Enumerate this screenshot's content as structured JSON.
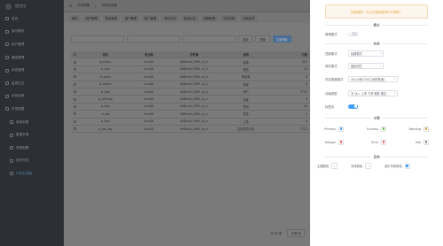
{
  "sidebar": {
    "logo_text": "很拉拉",
    "items": [
      {
        "label": "首页",
        "has_chev": false,
        "sub": false,
        "active": false
      },
      {
        "label": "演示模块",
        "has_chev": true,
        "sub": false,
        "active": false
      },
      {
        "label": "用户管理",
        "has_chev": true,
        "sub": false,
        "active": false
      },
      {
        "label": "通信管理",
        "has_chev": true,
        "sub": false,
        "active": false
      },
      {
        "label": "系统管理",
        "has_chev": true,
        "sub": false,
        "active": false
      },
      {
        "label": "监测日志",
        "has_chev": true,
        "sub": false,
        "active": false
      },
      {
        "label": "系统运维",
        "has_chev": true,
        "sub": false,
        "active": false
      },
      {
        "label": "开发配置",
        "has_chev": true,
        "sub": false,
        "active": false
      },
      {
        "label": "菜单权限",
        "has_chev": false,
        "sub": true,
        "active": false
      },
      {
        "label": "数据字典",
        "has_chev": false,
        "sub": true,
        "active": false
      },
      {
        "label": "参数配置",
        "has_chev": false,
        "sub": true,
        "active": false
      },
      {
        "label": "定时任务",
        "has_chev": false,
        "sub": true,
        "active": false
      },
      {
        "label": "代码生成器",
        "has_chev": false,
        "sub": true,
        "active": true
      }
    ]
  },
  "topbar": {
    "breadcrumb": [
      "开发配置",
      "代码生成器"
    ]
  },
  "tabs": [
    "首页",
    "用户管理",
    "角色管理",
    "部门管理",
    "部门管理",
    "操作日志",
    "登录日志",
    "参数配置",
    "文件列表",
    "代码生成"
  ],
  "filter": {
    "input1": "...",
    "input2": "...",
    "input3": "...",
    "search_label": "查询",
    "reset_label": "重置",
    "add_label": "生成代码"
  },
  "table": {
    "headers": [
      "表名",
      "表注释",
      "字符集",
      "说明",
      "行数"
    ],
    "rows": [
      [
        "b_menu",
        "inno08",
        "utf8mb4_0900_ai_ci",
        "菜单",
        "321"
      ],
      [
        "b_role",
        "inno08",
        "utf8mb4_0900_ai_ci",
        "角色",
        "14"
      ],
      [
        "b_perm",
        "inno08",
        "utf8mb4_0900_ai_ci",
        "商品类",
        "8"
      ],
      [
        "b_setpar",
        "inno08",
        "utf8mb4_0900_ai_ci",
        "参数",
        "0"
      ],
      [
        "b_user",
        "inno08",
        "utf8mb4_0900_ai_ci",
        "用户",
        "2747"
      ],
      [
        "b_settings",
        "inno08",
        "utf8mb4_0900_ai_ci",
        "设置",
        "0"
      ],
      [
        "b_sign",
        "inno08",
        "utf8mb4_0900_ai_ci",
        "签到",
        "22"
      ],
      [
        "b_xdt",
        "inno08",
        "utf8mb4_0900_ai_ci",
        "任务",
        "2"
      ],
      [
        "b_tool",
        "inno08",
        "utf8mb4_0900_ai_ci",
        "工具",
        "0"
      ],
      [
        "b_job_log",
        "inno08",
        "utf8mb4_0900_ai_ci",
        "定时任务日志",
        "1722"
      ]
    ]
  },
  "pager": {
    "total": "共 36 条",
    "size": "10条/页"
  },
  "settings": {
    "alert": "你是谁呀，可以引导给提供什么帮助？",
    "sections": {
      "mode": "模式",
      "layout": "布局",
      "theme": "主题",
      "other": "其他"
    },
    "dark_mode_label": "暗黑模式",
    "layout_label": "顶部模式",
    "layout_value": "经典模式",
    "sidebar_label": "侧栏模式",
    "sidebar_value": "固定侧栏",
    "content_label": "内容宽度模式",
    "content_value": "大小(0到1200之间的宽度)",
    "anim_label": "动画类型",
    "anim_value": "无 淡入 上滑 下滑 缩放 推拉",
    "tag_label": "标签页",
    "colors": [
      {
        "name": "Primary",
        "color": "#409eff"
      },
      {
        "name": "Success",
        "color": "#67c23a"
      },
      {
        "name": "Warning",
        "color": "#e6a23c"
      },
      {
        "name": "Danger",
        "color": "#f56c6c"
      },
      {
        "name": "Error",
        "color": "#f56c6c"
      },
      {
        "name": "Info",
        "color": "#909399"
      }
    ],
    "other_items": [
      "主题颜色",
      "字体颜色",
      "选中字体颜色"
    ],
    "other_color": "#409eff"
  }
}
